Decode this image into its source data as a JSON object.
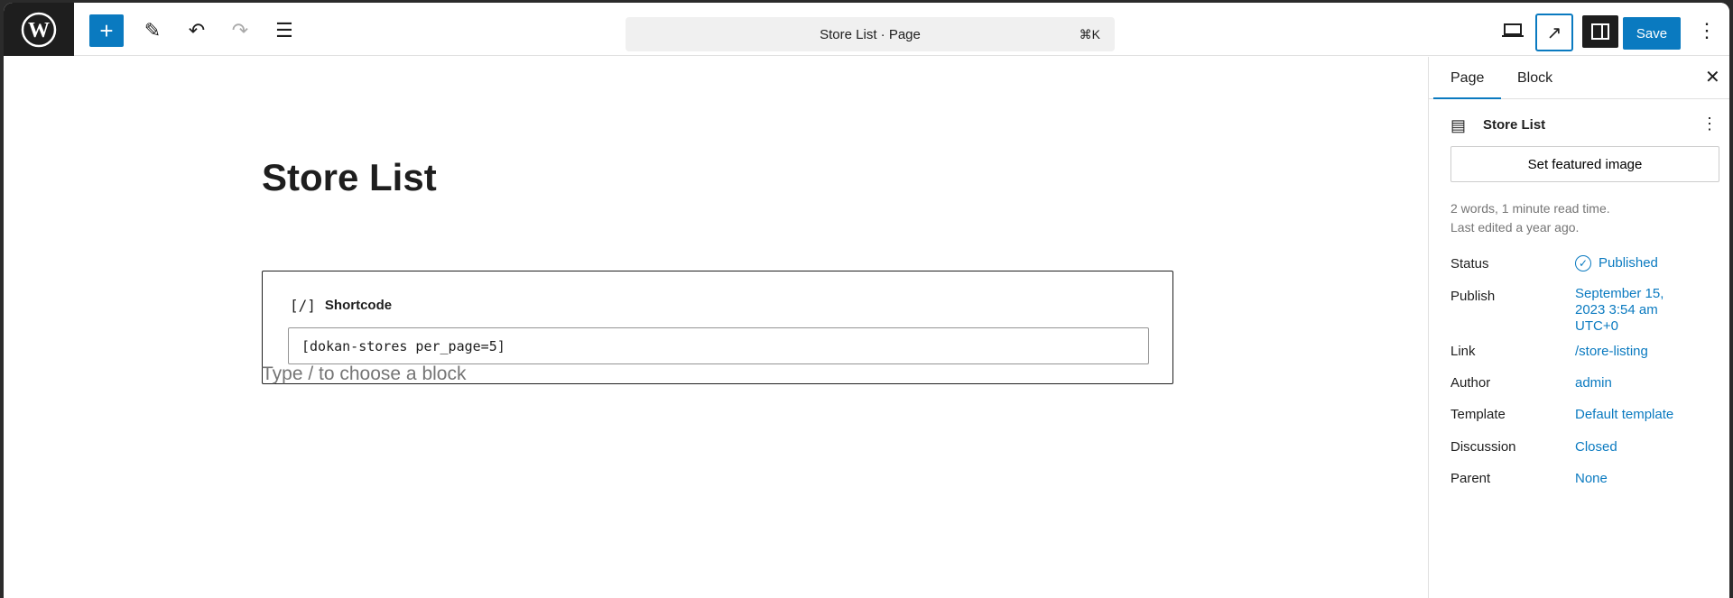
{
  "toolbar": {
    "command_title": "Store List · Page",
    "command_shortcut": "⌘K",
    "save_label": "Save"
  },
  "editor": {
    "title": "Store List",
    "shortcode_label": "Shortcode",
    "shortcode_icon": "[/]",
    "shortcode_value": "[dokan-stores per_page=5]",
    "placeholder": "Type / to choose a block"
  },
  "sidebar": {
    "tabs": [
      "Page",
      "Block"
    ],
    "page_title": "Store List",
    "featured_image_button": "Set featured image",
    "word_count": "2 words, 1 minute read time.",
    "last_edited": "Last edited a year ago.",
    "rows": [
      {
        "label": "Status",
        "value": "Published"
      },
      {
        "label": "Publish",
        "value": "September 15, 2023 3:54 am UTC+0"
      },
      {
        "label": "Link",
        "value": "/store-listing"
      },
      {
        "label": "Author",
        "value": "admin"
      },
      {
        "label": "Template",
        "value": "Default template"
      },
      {
        "label": "Discussion",
        "value": "Closed"
      },
      {
        "label": "Parent",
        "value": "None"
      }
    ]
  },
  "colors": {
    "accent": "#0a7ac0",
    "dark": "#1e1e1e"
  }
}
